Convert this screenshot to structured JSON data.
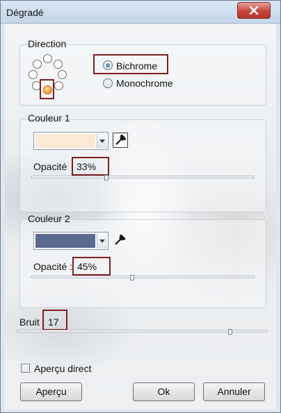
{
  "window": {
    "title": "Dégradé"
  },
  "direction": {
    "title": "Direction",
    "options": [
      "Bichrome",
      "Monochrome"
    ],
    "selected_option": "Bichrome"
  },
  "color1": {
    "title": "Couleur 1",
    "opacity_label": "Opacité",
    "opacity_value": "33%",
    "opacity": 0.33,
    "swatch_color": "#fbe9d6"
  },
  "color2": {
    "title": "Couleur 2",
    "opacity_label": "Opacité :",
    "opacity_value": "45%",
    "opacity": 0.45,
    "swatch_color": "#5c6a90"
  },
  "noise": {
    "label": "Bruit :",
    "value": "17",
    "level": 0.17
  },
  "preview": {
    "label": "Aperçu direct",
    "checked": false
  },
  "buttons": {
    "preview": "Aperçu",
    "ok": "Ok",
    "cancel": "Annuler"
  },
  "colors": {
    "highlight_frame": "#7e1e1e",
    "close_button": "#c8453a",
    "selected_direction": "#f0a030"
  }
}
